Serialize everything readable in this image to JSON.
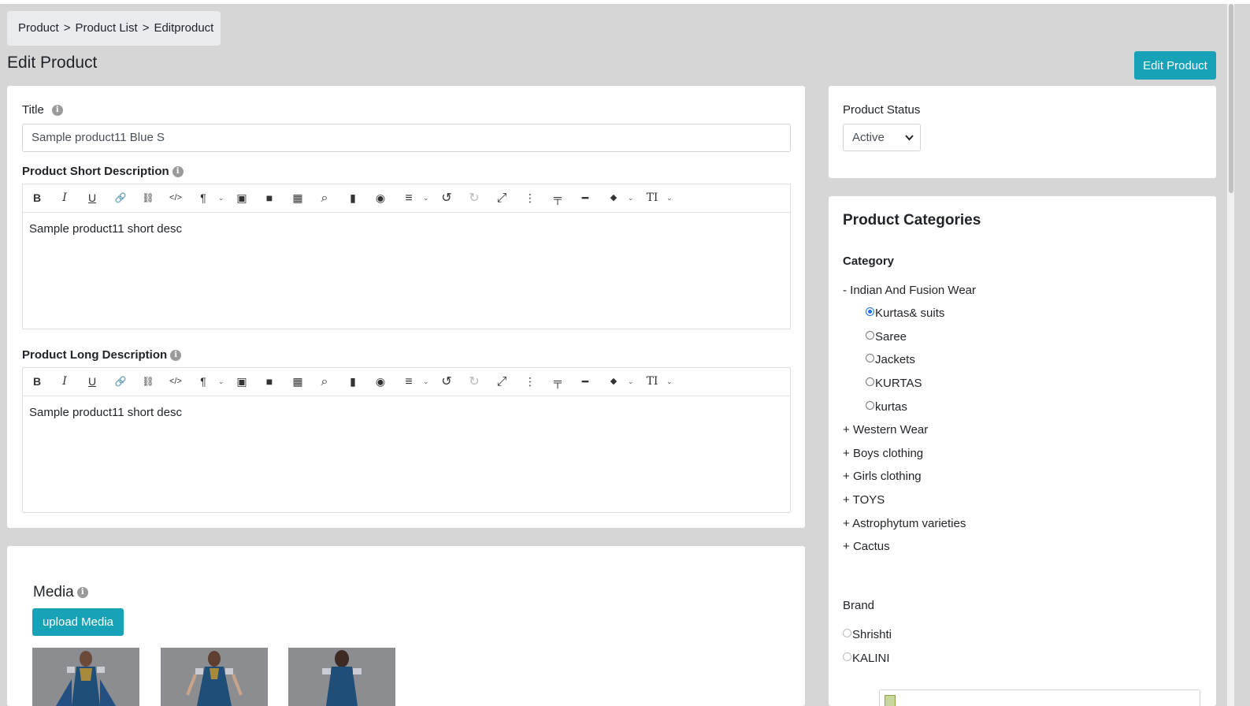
{
  "breadcrumb": {
    "items": [
      "Product",
      "Product List",
      "Editproduct"
    ],
    "separator": ">"
  },
  "page_title": "Edit Product",
  "header_button": "Edit Product",
  "form": {
    "title_label": "Title",
    "title_value": "Sample product11 Blue S",
    "short_desc_label": "Product Short Description",
    "short_desc_value": "Sample product11 short desc",
    "long_desc_label": "Product Long Description",
    "long_desc_value": "Sample product11 short desc"
  },
  "toolbar_icons": [
    "bold-icon",
    "italic-icon",
    "underline-icon",
    "link-icon",
    "unlink-icon",
    "code-view-icon",
    "paragraph-icon",
    "image-icon",
    "video-icon",
    "table-icon",
    "find-icon",
    "document-icon",
    "preview-icon",
    "align-icon",
    "undo-icon",
    "redo-icon",
    "fullscreen-icon",
    "more-icon",
    "paint-format-icon",
    "horizontal-rule-icon",
    "color-icon",
    "font-size-icon"
  ],
  "toolbar_glyphs": {
    "bold": "B",
    "italic": "I",
    "underline": "U",
    "link": "🔗",
    "unlink": "⛓",
    "code": "</>",
    "paragraph": "¶",
    "image": "▣",
    "video": "■",
    "table": "▦",
    "find": "⌕",
    "document": "▮",
    "preview": "◉",
    "align": "≡",
    "undo": "↺",
    "redo": "↻",
    "fullscreen": "⤢",
    "more": "⋮",
    "paint": "╤",
    "hr": "━",
    "color": "◆",
    "fontsize": "TI",
    "caret": "⌄"
  },
  "status": {
    "label": "Product Status",
    "selected": "Active"
  },
  "categories": {
    "heading": "Product Categories",
    "subheading": "Category",
    "tree": [
      {
        "label": "Indian And Fusion Wear",
        "toggle": "-",
        "expanded": true,
        "children": [
          {
            "label": "Kurtas& suits",
            "checked": true
          },
          {
            "label": "Saree",
            "checked": false
          },
          {
            "label": "Jackets",
            "checked": false
          },
          {
            "label": "KURTAS",
            "checked": false
          },
          {
            "label": "kurtas",
            "checked": false
          }
        ]
      },
      {
        "label": "Western Wear",
        "toggle": "+"
      },
      {
        "label": "Boys clothing",
        "toggle": "+"
      },
      {
        "label": "Girls clothing",
        "toggle": "+"
      },
      {
        "label": "TOYS",
        "toggle": "+"
      },
      {
        "label": "Astrophytum varieties",
        "toggle": "+"
      },
      {
        "label": "Cactus",
        "toggle": "+"
      }
    ]
  },
  "brand": {
    "label": "Brand",
    "options": [
      "Shrishti",
      "KALINI"
    ]
  },
  "media": {
    "title": "Media",
    "upload_label": "upload Media",
    "thumbnail_count": 3
  },
  "colors": {
    "accent": "#17a2b8",
    "background": "#d6d6d6",
    "card": "#ffffff"
  }
}
